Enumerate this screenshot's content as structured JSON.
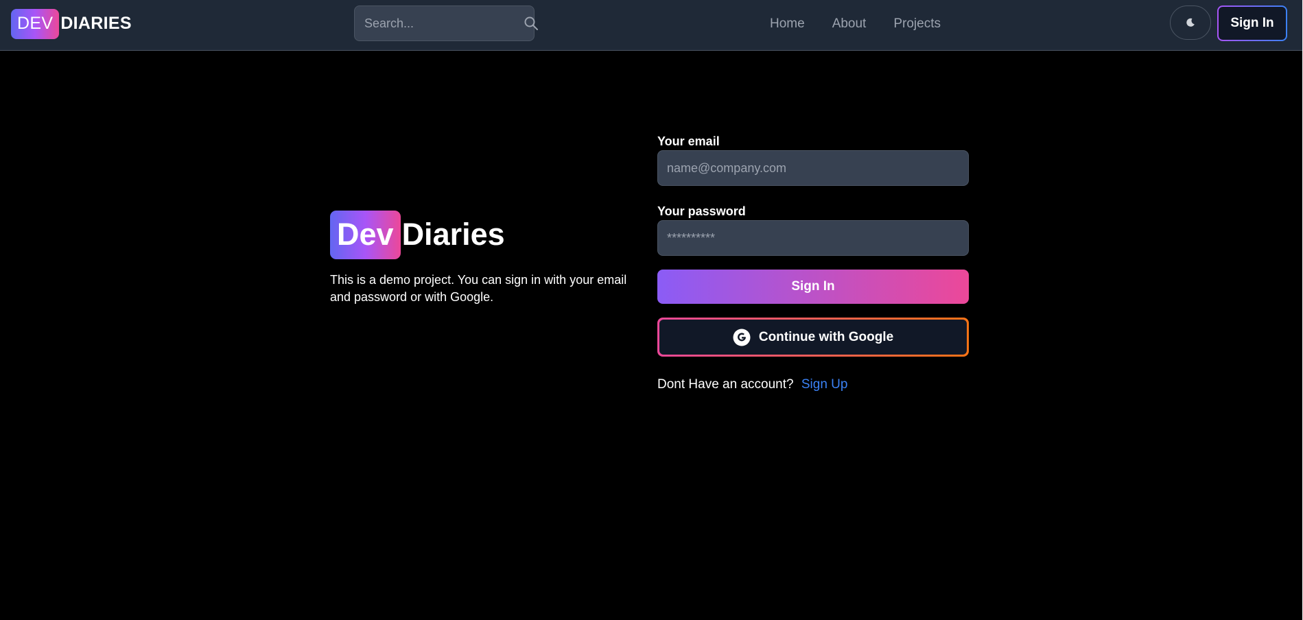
{
  "header": {
    "brand_box": "DEV",
    "brand_text": "DIARIES",
    "search_placeholder": "Search...",
    "nav": [
      {
        "label": "Home"
      },
      {
        "label": "About"
      },
      {
        "label": "Projects"
      }
    ],
    "theme_icon": "moon-icon",
    "signin_label": "Sign In"
  },
  "hero": {
    "title_box": "Dev",
    "title_text": "Diaries",
    "description": "This is a demo project. You can sign in with your email and password or with Google."
  },
  "form": {
    "email_label": "Your email",
    "email_placeholder": "name@company.com",
    "password_label": "Your password",
    "password_placeholder": "**********",
    "signin_label": "Sign In",
    "google_label": "Continue with Google",
    "google_icon": "google-icon",
    "no_account_text": "Dont Have an account?",
    "signup_link": "Sign Up"
  },
  "colors": {
    "page_bg": "#000000",
    "header_bg": "#1f2937",
    "input_bg": "#374151",
    "gradient_from": "#8b5cf6",
    "gradient_to": "#ec4899",
    "link": "#3b82f6"
  }
}
